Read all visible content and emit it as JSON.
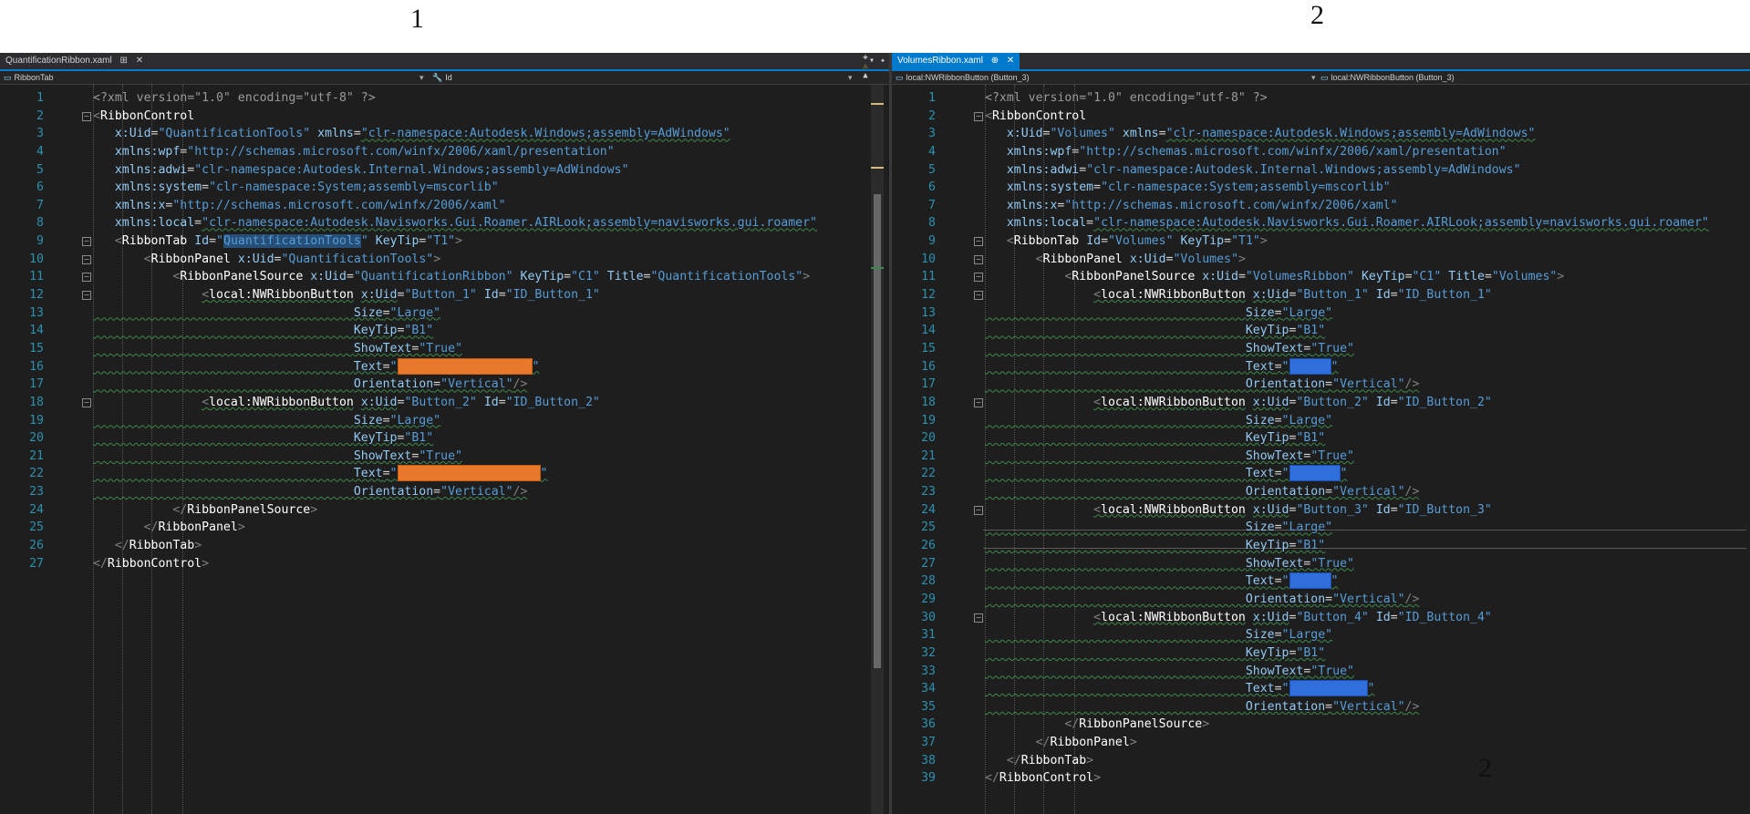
{
  "labels": {
    "left": "1",
    "right": "2",
    "bottom_right": "2"
  },
  "left": {
    "tab": {
      "title": "QuantificationRibbon.xaml",
      "pin": "⊞",
      "close": "✕"
    },
    "nav": {
      "type": "RibbonTab",
      "member": "Id"
    },
    "lines": [
      {
        "n": "1"
      },
      {
        "n": "2"
      },
      {
        "n": "3"
      },
      {
        "n": "4"
      },
      {
        "n": "5"
      },
      {
        "n": "6"
      },
      {
        "n": "7"
      },
      {
        "n": "8"
      },
      {
        "n": "9"
      },
      {
        "n": "10"
      },
      {
        "n": "11"
      },
      {
        "n": "12"
      },
      {
        "n": "13"
      },
      {
        "n": "14"
      },
      {
        "n": "15"
      },
      {
        "n": "16"
      },
      {
        "n": "17"
      },
      {
        "n": "18"
      },
      {
        "n": "19"
      },
      {
        "n": "20"
      },
      {
        "n": "21"
      },
      {
        "n": "22"
      },
      {
        "n": "23"
      },
      {
        "n": "24"
      },
      {
        "n": "25"
      },
      {
        "n": "26"
      },
      {
        "n": "27"
      }
    ],
    "code": {
      "xml_decl": "<?xml version=\"1.0\" encoding=\"utf-8\" ?>",
      "ribbon_control": "RibbonControl",
      "uid": "\"QuantificationTools\"",
      "ns_adwin": "\"clr-namespace:Autodesk.Windows;assembly=AdWindows\"",
      "ns_wpf": "\"http://schemas.microsoft.com/winfx/2006/xaml/presentation\"",
      "ns_adwi": "\"clr-namespace:Autodesk.Internal.Windows;assembly=AdWindows\"",
      "ns_system": "\"clr-namespace:System;assembly=mscorlib\"",
      "ns_x": "\"http://schemas.microsoft.com/winfx/2006/xaml\"",
      "ns_local": "\"clr-namespace:Autodesk.Navisworks.Gui.Roamer.AIRLook;assembly=navisworks.gui.roamer\"",
      "tab_id": "QuantificationTools",
      "keytip_t1": "\"T1\"",
      "panel_uid": "\"QuantificationTools\"",
      "source_uid": "\"QuantificationRibbon\"",
      "keytip_c1": "\"C1\"",
      "source_title": "\"QuantificationTools\"",
      "b1_uid": "\"Button_1\"",
      "b1_id": "\"ID_Button_1\"",
      "b2_uid": "\"Button_2\"",
      "b2_id": "\"ID_Button_2\"",
      "size": "\"Large\"",
      "keytip_b1": "\"B1\"",
      "showtext": "\"True\"",
      "orientation": "\"Vertical\""
    }
  },
  "right": {
    "tab": {
      "title": "VolumesRibbon.xaml",
      "pin": "⊕",
      "close": "✕"
    },
    "nav": {
      "left": "local:NWRibbonButton (Button_3)",
      "right": "local:NWRibbonButton (Button_3)"
    },
    "lines": [
      {
        "n": "1"
      },
      {
        "n": "2"
      },
      {
        "n": "3"
      },
      {
        "n": "4"
      },
      {
        "n": "5"
      },
      {
        "n": "6"
      },
      {
        "n": "7"
      },
      {
        "n": "8"
      },
      {
        "n": "9"
      },
      {
        "n": "10"
      },
      {
        "n": "11"
      },
      {
        "n": "12"
      },
      {
        "n": "13"
      },
      {
        "n": "14"
      },
      {
        "n": "15"
      },
      {
        "n": "16"
      },
      {
        "n": "17"
      },
      {
        "n": "18"
      },
      {
        "n": "19"
      },
      {
        "n": "20"
      },
      {
        "n": "21"
      },
      {
        "n": "22"
      },
      {
        "n": "23"
      },
      {
        "n": "24"
      },
      {
        "n": "25"
      },
      {
        "n": "26"
      },
      {
        "n": "27"
      },
      {
        "n": "28"
      },
      {
        "n": "29"
      },
      {
        "n": "30"
      },
      {
        "n": "31"
      },
      {
        "n": "32"
      },
      {
        "n": "33"
      },
      {
        "n": "34"
      },
      {
        "n": "35"
      },
      {
        "n": "36"
      },
      {
        "n": "37"
      },
      {
        "n": "38"
      },
      {
        "n": "39"
      }
    ],
    "code": {
      "uid": "\"Volumes\"",
      "tab_id": "\"Volumes\"",
      "panel_uid": "\"Volumes\"",
      "source_uid": "\"VolumesRibbon\"",
      "source_title": "\"Volumes\"",
      "b1_uid": "\"Button_1\"",
      "b1_id": "\"ID_Button_1\"",
      "b2_uid": "\"Button_2\"",
      "b2_id": "\"ID_Button_2\"",
      "b3_uid": "\"Button_3\"",
      "b3_id": "\"ID_Button_3\"",
      "b4_uid": "\"Button_4\"",
      "b4_id": "\"ID_Button_4\""
    }
  },
  "colors": {
    "accent": "#007acc",
    "redact_orange": "#e8792c",
    "redact_blue": "#2f6fdc",
    "editor_bg": "#1e1e1e"
  }
}
